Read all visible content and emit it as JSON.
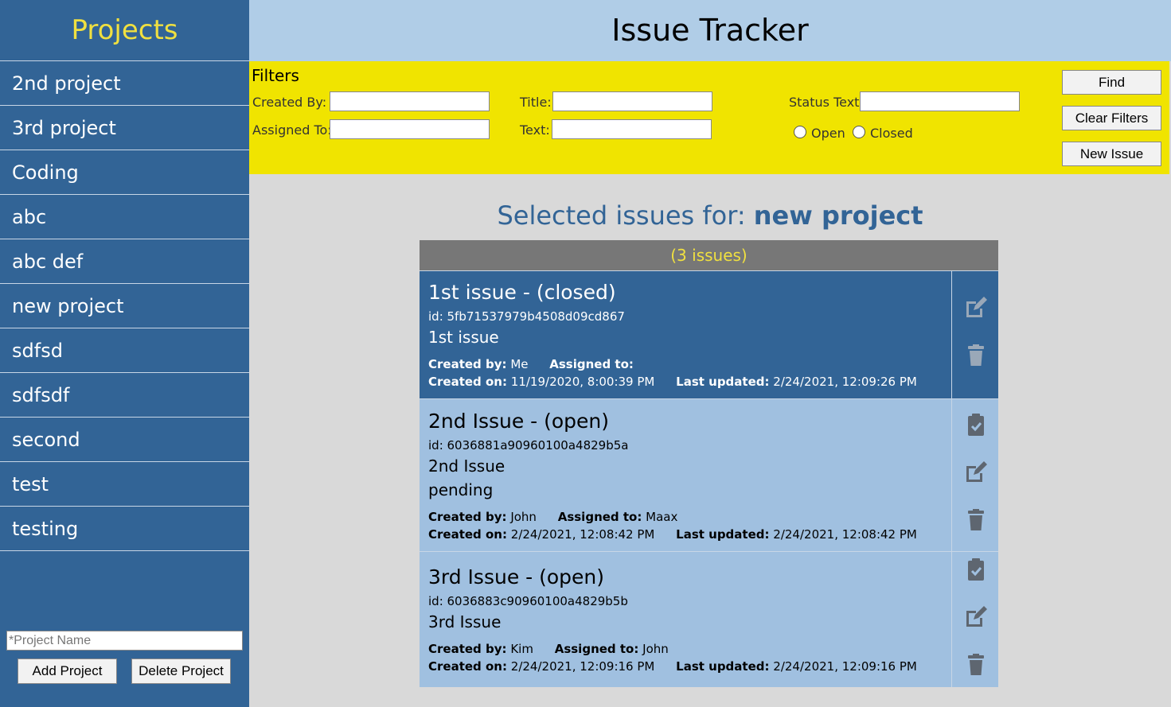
{
  "sidebar": {
    "title": "Projects",
    "projects": [
      "2nd project",
      "3rd project",
      "Coding",
      "abc",
      "abc def",
      "new project",
      "sdfsd",
      "sdfsdf",
      "second",
      "test",
      "testing"
    ],
    "project_name_placeholder": "*Project Name",
    "add_label": "Add Project",
    "delete_label": "Delete Project"
  },
  "header": {
    "title": "Issue Tracker"
  },
  "filters": {
    "title": "Filters",
    "created_by_label": "Created By:",
    "assigned_to_label": "Assigned To:",
    "title_label": "Title:",
    "text_label": "Text:",
    "status_text_label": "Status Text:",
    "open_label": "Open",
    "closed_label": "Closed",
    "find_label": "Find",
    "clear_label": "Clear Filters",
    "new_issue_label": "New Issue"
  },
  "main": {
    "heading_prefix": "Selected issues for:",
    "project": "new project",
    "count": "(3 issues)",
    "issues": [
      {
        "title": "1st issue - (closed)",
        "id": "id: 5fb71537979b4508d09cd867",
        "text": "1st issue",
        "status_text": "",
        "created_by_label": "Created by:",
        "created_by": "Me",
        "assigned_to_label": "Assigned to:",
        "assigned_to": "",
        "created_on_label": "Created on:",
        "created_on": "11/19/2020, 8:00:39 PM",
        "last_updated_label": "Last updated:",
        "last_updated": "2/24/2021, 12:09:26 PM"
      },
      {
        "title": "2nd Issue - (open)",
        "id": "id: 6036881a90960100a4829b5a",
        "text": "2nd Issue",
        "status_text": "pending",
        "created_by_label": "Created by:",
        "created_by": "John",
        "assigned_to_label": "Assigned to:",
        "assigned_to": "Maax",
        "created_on_label": "Created on:",
        "created_on": "2/24/2021, 12:08:42 PM",
        "last_updated_label": "Last updated:",
        "last_updated": "2/24/2021, 12:08:42 PM"
      },
      {
        "title": "3rd Issue - (open)",
        "id": "id: 6036883c90960100a4829b5b",
        "text": "3rd Issue",
        "status_text": "",
        "created_by_label": "Created by:",
        "created_by": "Kim",
        "assigned_to_label": "Assigned to:",
        "assigned_to": "John",
        "created_on_label": "Created on:",
        "created_on": "2/24/2021, 12:09:16 PM",
        "last_updated_label": "Last updated:",
        "last_updated": "2/24/2021, 12:09:16 PM"
      }
    ]
  },
  "icons": [
    "clipboard-check-icon",
    "edit-icon",
    "trash-icon"
  ]
}
